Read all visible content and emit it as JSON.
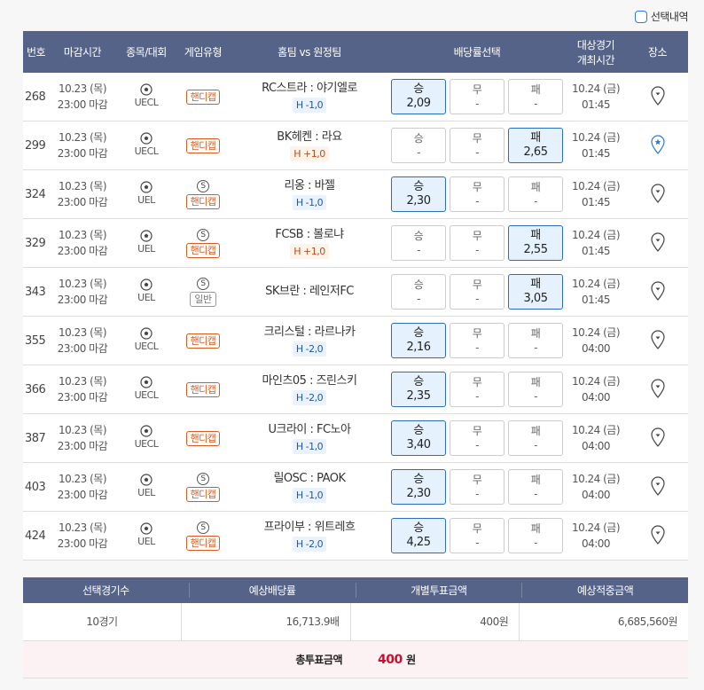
{
  "top": {
    "selection_label": "선택내역"
  },
  "header": {
    "no": "번호",
    "deadline": "마감시간",
    "sport": "종목/대회",
    "type": "게임유형",
    "teams": "홈팀 vs 원정팀",
    "odds": "배당률선택",
    "match_time_1": "대상경기",
    "match_time_2": "개최시간",
    "venue": "장소"
  },
  "odds_labels": {
    "win": "승",
    "draw": "무",
    "lose": "패"
  },
  "rows": [
    {
      "no": "268",
      "date": "10.23 (목)",
      "close": "23:00 마감",
      "league": "UECL",
      "special": false,
      "type": "핸디캡",
      "teams": "RC스트라 : 야기엘로",
      "hc": "H -1,0",
      "hc_sign": "m",
      "win": "2,09",
      "draw": "-",
      "lose": "-",
      "sel": "win",
      "mdate": "10.24 (금)",
      "mtime": "01:45",
      "pin": "pin"
    },
    {
      "no": "299",
      "date": "10.23 (목)",
      "close": "23:00 마감",
      "league": "UECL",
      "special": false,
      "type": "핸디캡",
      "teams": "BK헤켄 : 라요",
      "hc": "H +1,0",
      "hc_sign": "p",
      "win": "-",
      "draw": "-",
      "lose": "2,65",
      "sel": "lose",
      "mdate": "10.24 (금)",
      "mtime": "01:45",
      "pin": "star"
    },
    {
      "no": "324",
      "date": "10.23 (목)",
      "close": "23:00 마감",
      "league": "UEL",
      "special": true,
      "type": "핸디캡",
      "teams": "리옹 : 바젤",
      "hc": "H -1,0",
      "hc_sign": "m",
      "win": "2,30",
      "draw": "-",
      "lose": "-",
      "sel": "win",
      "mdate": "10.24 (금)",
      "mtime": "01:45",
      "pin": "pin"
    },
    {
      "no": "329",
      "date": "10.23 (목)",
      "close": "23:00 마감",
      "league": "UEL",
      "special": true,
      "type": "핸디캡",
      "teams": "FCSB : 볼로냐",
      "hc": "H +1,0",
      "hc_sign": "p",
      "win": "-",
      "draw": "-",
      "lose": "2,55",
      "sel": "lose",
      "mdate": "10.24 (금)",
      "mtime": "01:45",
      "pin": "pin"
    },
    {
      "no": "343",
      "date": "10.23 (목)",
      "close": "23:00 마감",
      "league": "UEL",
      "special": true,
      "type": "일반",
      "teams": "SK브란 : 레인저FC",
      "hc": "",
      "hc_sign": "",
      "win": "-",
      "draw": "-",
      "lose": "3,05",
      "sel": "lose",
      "mdate": "10.24 (금)",
      "mtime": "01:45",
      "pin": "pin"
    },
    {
      "no": "355",
      "date": "10.23 (목)",
      "close": "23:00 마감",
      "league": "UECL",
      "special": false,
      "type": "핸디캡",
      "teams": "크리스털 : 라르나카",
      "hc": "H -2,0",
      "hc_sign": "m",
      "win": "2,16",
      "draw": "-",
      "lose": "-",
      "sel": "win",
      "mdate": "10.24 (금)",
      "mtime": "04:00",
      "pin": "pin"
    },
    {
      "no": "366",
      "date": "10.23 (목)",
      "close": "23:00 마감",
      "league": "UECL",
      "special": false,
      "type": "핸디캡",
      "teams": "마인츠05 : 즈린스키",
      "hc": "H -2,0",
      "hc_sign": "m",
      "win": "2,35",
      "draw": "-",
      "lose": "-",
      "sel": "win",
      "mdate": "10.24 (금)",
      "mtime": "04:00",
      "pin": "pin"
    },
    {
      "no": "387",
      "date": "10.23 (목)",
      "close": "23:00 마감",
      "league": "UECL",
      "special": false,
      "type": "핸디캡",
      "teams": "U크라이 : FC노아",
      "hc": "H -1,0",
      "hc_sign": "m",
      "win": "3,40",
      "draw": "-",
      "lose": "-",
      "sel": "win",
      "mdate": "10.24 (금)",
      "mtime": "04:00",
      "pin": "pin"
    },
    {
      "no": "403",
      "date": "10.23 (목)",
      "close": "23:00 마감",
      "league": "UEL",
      "special": true,
      "type": "핸디캡",
      "teams": "릴OSC : PAOK",
      "hc": "H -1,0",
      "hc_sign": "m",
      "win": "2,30",
      "draw": "-",
      "lose": "-",
      "sel": "win",
      "mdate": "10.24 (금)",
      "mtime": "04:00",
      "pin": "pin"
    },
    {
      "no": "424",
      "date": "10.23 (목)",
      "close": "23:00 마감",
      "league": "UEL",
      "special": true,
      "type": "핸디캡",
      "teams": "프라이부 : 위트레흐",
      "hc": "H -2,0",
      "hc_sign": "m",
      "win": "4,25",
      "draw": "-",
      "lose": "-",
      "sel": "win",
      "mdate": "10.24 (금)",
      "mtime": "04:00",
      "pin": "pin"
    }
  ],
  "special_badge": "S",
  "summary": {
    "h1": "선택경기수",
    "h2": "예상배당률",
    "h3": "개별투표금액",
    "h4": "예상적중금액",
    "v1": "10경기",
    "v2": "16,713.9배",
    "v3": "400원",
    "v4": "6,685,560원",
    "total_label": "총투표금액",
    "total_value": "400",
    "total_unit": "원"
  }
}
